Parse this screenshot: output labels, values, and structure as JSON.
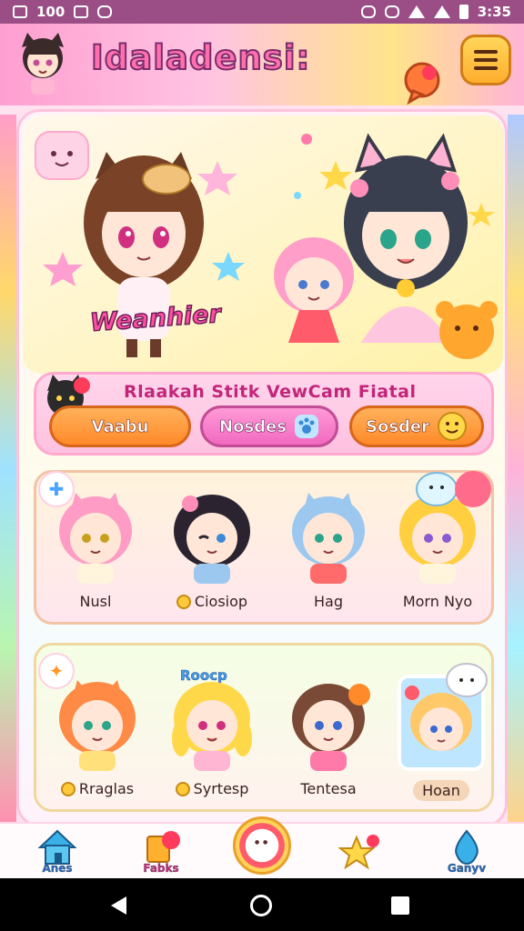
{
  "status_bar": {
    "left_text": "100",
    "time": "3:35"
  },
  "header": {
    "title": "Idaladensi:"
  },
  "hero": {
    "badge": "Weanhier"
  },
  "actions": {
    "caption": "Rlaakah Stitk  VewCam    Fiatal",
    "buttons": [
      {
        "label": "Vaabu"
      },
      {
        "label": "Nosdes"
      },
      {
        "label": "Sosder"
      }
    ]
  },
  "row_1": {
    "characters": [
      {
        "name": "Nusl",
        "coin": false,
        "hair": "#ff9cc6"
      },
      {
        "name": "Ciosiop",
        "coin": true,
        "hair": "#2b2430"
      },
      {
        "name": "Hag",
        "coin": false,
        "hair": "#9cc8ef"
      },
      {
        "name": "Morn Nyo",
        "coin": false,
        "hair": "#ffcf3f"
      }
    ]
  },
  "row_2": {
    "tag_word": "Roocp",
    "characters": [
      {
        "name": "Rraglas",
        "coin": true,
        "hair": "#ff8a45"
      },
      {
        "name": "Syrtesp",
        "coin": true,
        "hair": "#ffd84a"
      },
      {
        "name": "Tentesa",
        "coin": false,
        "hair": "#7b4a36"
      },
      {
        "name": "Hoan",
        "coin": false,
        "hair": "#ffc96a",
        "pill": true
      }
    ]
  },
  "bottom_nav": [
    {
      "label": "Anes",
      "icon": "home-icon"
    },
    {
      "label": "Fabks",
      "icon": "book-icon"
    },
    {
      "label": "",
      "icon": "center-face-icon"
    },
    {
      "label": "",
      "icon": "star-icon"
    },
    {
      "label": "Ganyv",
      "icon": "drop-icon"
    }
  ],
  "colors": {
    "status_bar": "#9b4e86",
    "accent_pink": "#ff6fae",
    "accent_orange": "#ff8a2a"
  }
}
